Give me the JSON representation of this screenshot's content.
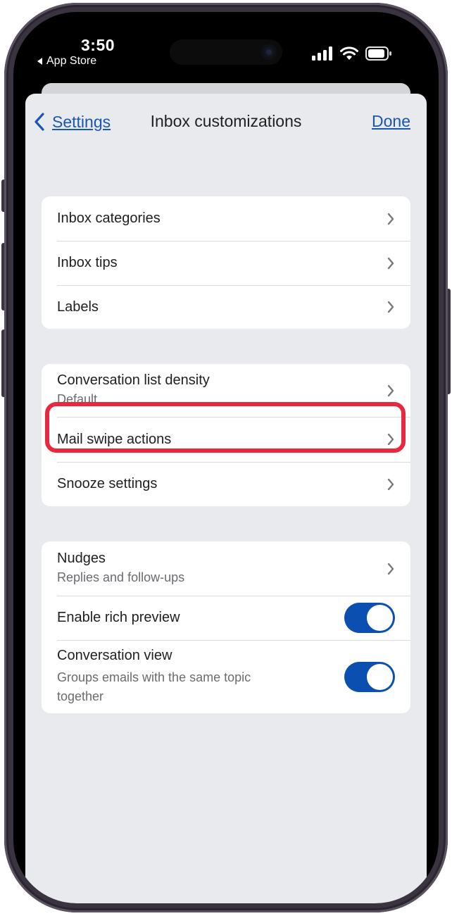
{
  "status_bar": {
    "time": "3:50",
    "back_app": "App Store"
  },
  "nav": {
    "back_label": "Settings",
    "title": "Inbox customizations",
    "done_label": "Done"
  },
  "groups": [
    {
      "rows": [
        {
          "title": "Inbox categories",
          "type": "chevron"
        },
        {
          "title": "Inbox tips",
          "type": "chevron"
        },
        {
          "title": "Labels",
          "type": "chevron"
        }
      ]
    },
    {
      "rows": [
        {
          "title": "Conversation list density",
          "subtitle": "Default",
          "type": "chevron"
        },
        {
          "title": "Mail swipe actions",
          "type": "chevron",
          "highlighted": true
        },
        {
          "title": "Snooze settings",
          "type": "chevron"
        }
      ]
    },
    {
      "rows": [
        {
          "title": "Nudges",
          "subtitle": "Replies and follow-ups",
          "type": "chevron"
        },
        {
          "title": "Enable rich preview",
          "type": "toggle",
          "on": true
        },
        {
          "title": "Conversation view",
          "subtitle": "Groups emails with the same topic together",
          "type": "toggle",
          "on": true
        }
      ]
    }
  ],
  "colors": {
    "accent": "#1a56b4",
    "toggle_on": "#0b4fb0",
    "highlight": "#e8283f",
    "background": "#e9eaee"
  }
}
